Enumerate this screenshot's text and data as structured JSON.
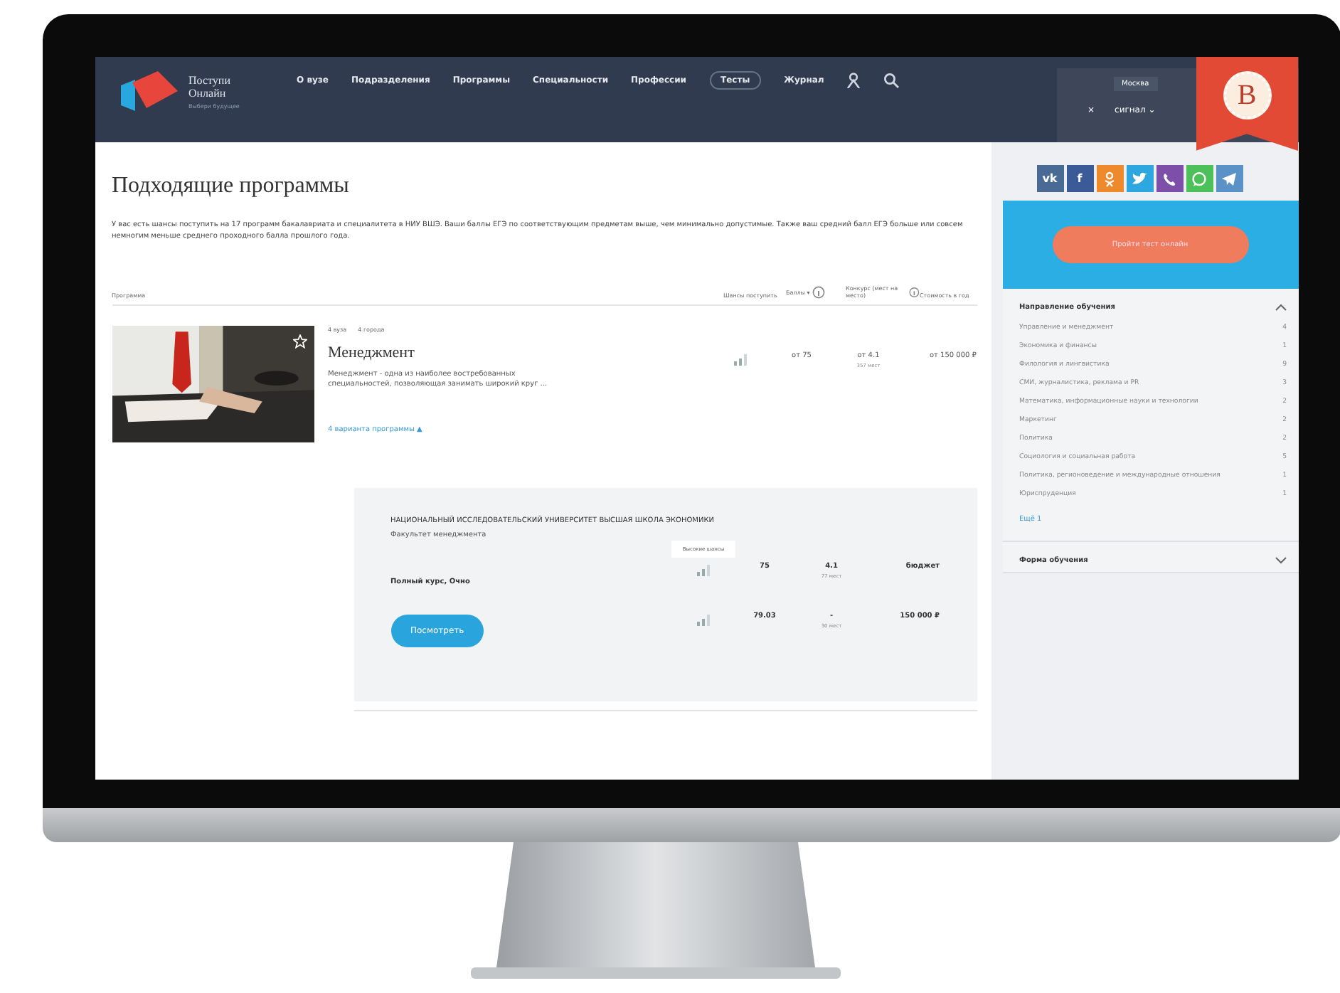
{
  "header": {
    "logo_lines": [
      "Поступи",
      "Онлайн"
    ],
    "tagline": "Выбери будущее",
    "nav": [
      {
        "label": "О вузе",
        "kind": "link"
      },
      {
        "label": "Подразделения",
        "kind": "link"
      },
      {
        "label": "Программы",
        "kind": "link"
      },
      {
        "label": "Специальности",
        "kind": "link"
      },
      {
        "label": "Профессии",
        "kind": "link"
      },
      {
        "label": "Тесты",
        "kind": "pill"
      },
      {
        "label": "Журнал",
        "kind": "link"
      }
    ],
    "city": "Москва",
    "close": "×",
    "menu": "сигнал ⌄"
  },
  "badge": {
    "letter": "В"
  },
  "page": {
    "title": "Подходящие программы",
    "intro": "У вас есть шансы поступить на 17 программ бакалавриата и специалитета в НИУ ВШЭ. Ваши баллы ЕГЭ по соответствующим предметам выше, чем минимально допустимые. Также ваш средний балл ЕГЭ больше или совсем немногим меньше среднего проходного балла прошлого года.",
    "columns": [
      {
        "label": "Программа",
        "info": false
      },
      {
        "label": "Шансы поступить",
        "info": false
      },
      {
        "label": "Баллы ▾",
        "info": true
      },
      {
        "label": "Конкурс (мест на место)",
        "info": true
      },
      {
        "label": "Стоимость в год",
        "info": false
      }
    ],
    "programs": [
      {
        "tags": [
          "4 вуза",
          "4 города"
        ],
        "favorite": false,
        "title": "Менеджмент",
        "description": "Менеджмент - одна из наиболее востребованных специальностей, позволяющая занимать широкий круг ...",
        "score": "от 75",
        "competition": "от 4.1",
        "competition_note": "357 мест",
        "price": "от 150 000 ₽",
        "variants_link": "4 варианта программы ▲"
      }
    ],
    "variant": {
      "university": "НАЦИОНАЛЬНЫЙ ИССЛЕДОВАТЕЛЬСКИЙ УНИВЕРСИТЕТ ВЫСШАЯ ШКОЛА ЭКОНОМИКИ",
      "faculty": "Факультет менеджмента",
      "tooltip": "Высокие шансы",
      "rows": [
        {
          "kind": "label",
          "label": "Полный курс, Очно",
          "score": "75",
          "competition": "4.1",
          "competition_note": "77 мест",
          "price": "бюджет"
        },
        {
          "kind": "button",
          "label": "Посмотреть",
          "score": "79.03",
          "competition": "-",
          "competition_note": "30 мест",
          "price": "150 000 ₽"
        }
      ]
    }
  },
  "sidebar": {
    "share": [
      {
        "kind": "vk",
        "glyph": "vk",
        "color": "#4a6a96"
      },
      {
        "kind": "facebook",
        "glyph": "f",
        "color": "#3b5a98"
      },
      {
        "kind": "ok",
        "color": "#ee8a2c"
      },
      {
        "kind": "twitter",
        "color": "#2ea6e0"
      },
      {
        "kind": "viber",
        "color": "#7d4fa8"
      },
      {
        "kind": "whatsapp",
        "color": "#4cc15a"
      },
      {
        "kind": "telegram",
        "color": "#5a92c8"
      }
    ],
    "cta": "Пройти тест онлайн",
    "filters": [
      {
        "title": "Направление обучения",
        "expanded": true,
        "items": [
          {
            "label": "Управление и менеджмент",
            "count": "4"
          },
          {
            "label": "Экономика и финансы",
            "count": "1"
          },
          {
            "label": "Филология и лингвистика",
            "count": "9"
          },
          {
            "label": "СМИ, журналистика, реклама и PR",
            "count": "3"
          },
          {
            "label": "Математика, информационные науки и технологии",
            "count": "2"
          },
          {
            "label": "Маркетинг",
            "count": "2"
          },
          {
            "label": "Политика",
            "count": "2"
          },
          {
            "label": "Социология и социальная работа",
            "count": "5"
          },
          {
            "label": "Политика, регионоведение и международные отношения",
            "count": "1"
          },
          {
            "label": "Юриспруденция",
            "count": "1"
          }
        ],
        "more": "Ещё 1"
      },
      {
        "title": "Форма обучения",
        "expanded": false
      }
    ]
  }
}
